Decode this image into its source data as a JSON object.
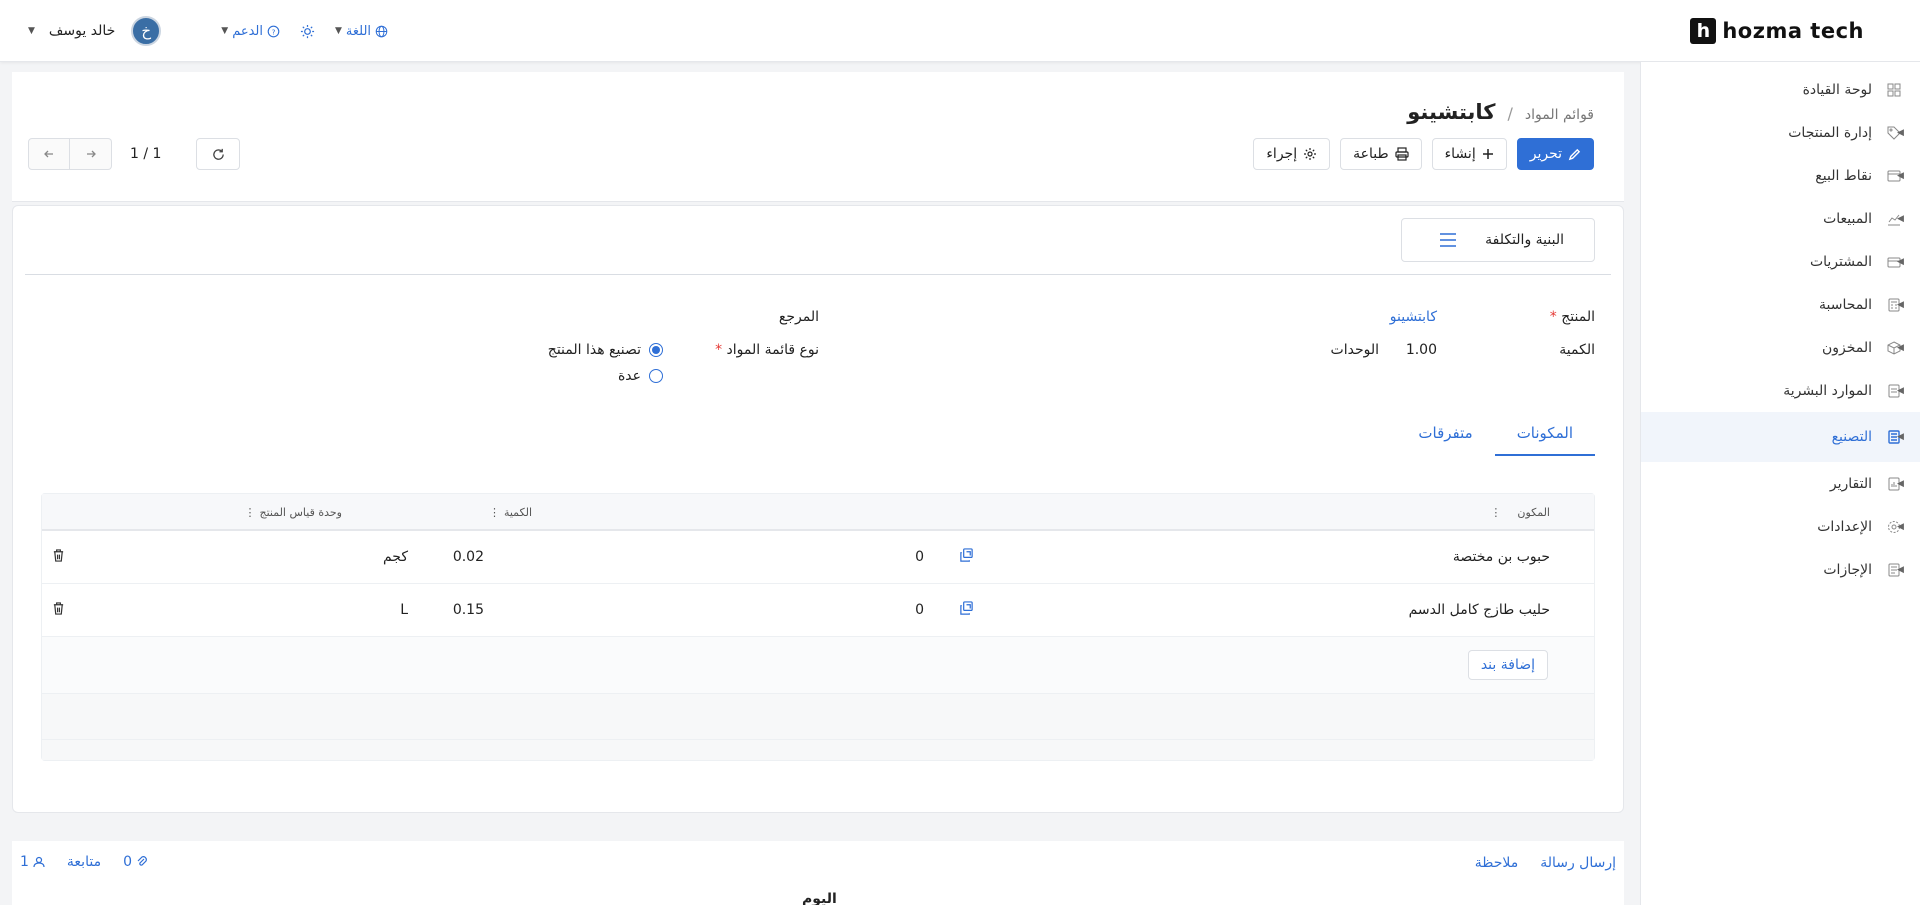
{
  "brand": {
    "logo_letter": "h",
    "name": "hozma tech"
  },
  "topbar": {
    "user_name": "خالد يوسف",
    "avatar_letter": "خ",
    "support_label": "الدعم",
    "language_label": "اللغة"
  },
  "sidebar": {
    "items": [
      {
        "label": "لوحة القيادة",
        "icon": "dashboard-icon"
      },
      {
        "label": "إدارة المنتجات",
        "icon": "tag-icon"
      },
      {
        "label": "نقاط البيع",
        "icon": "store-icon"
      },
      {
        "label": "المبيعات",
        "icon": "chart-icon"
      },
      {
        "label": "المشتريات",
        "icon": "cart-icon"
      },
      {
        "label": "المحاسبة",
        "icon": "calculator-icon"
      },
      {
        "label": "المخزون",
        "icon": "box-icon"
      },
      {
        "label": "الموارد البشرية",
        "icon": "people-icon"
      },
      {
        "label": "التصنيع",
        "icon": "factory-icon",
        "active": true
      },
      {
        "label": "التقارير",
        "icon": "report-icon"
      },
      {
        "label": "الإعدادات",
        "icon": "gear-icon"
      },
      {
        "label": "الإجازات",
        "icon": "calendar-icon"
      }
    ]
  },
  "header": {
    "breadcrumb_parent": "قوائم المواد",
    "breadcrumb_sep": "/",
    "title": "كابتشينو",
    "edit_label": "تحرير",
    "create_label": "إنشاء",
    "print_label": "طباعة",
    "action_label": "إجراء",
    "pager": "1 / 1"
  },
  "form": {
    "section_tab": "البنية والتكلفة",
    "product_label": "المنتج",
    "product_value": "كابتشينو",
    "qty_label": "الكمية",
    "qty_value": "1.00",
    "qty_unit": "الوحدات",
    "reference_label": "المرجع",
    "bom_type_label": "نوع قائمة المواد",
    "bom_type_options": [
      {
        "label": "تصنيع هذا المنتج",
        "selected": true
      },
      {
        "label": "عدة",
        "selected": false
      }
    ]
  },
  "tabs": [
    {
      "label": "المكونات",
      "active": true
    },
    {
      "label": "متفرقات",
      "active": false
    }
  ],
  "table": {
    "headers": {
      "component": "المكون",
      "quantity": "الكمية",
      "uom": "وحدة قياس المنتج"
    },
    "rows": [
      {
        "component": "حبوب بن مختصة",
        "mid": "0",
        "quantity": "0.02",
        "uom": "كجم"
      },
      {
        "component": "حليب طازج كامل الدسم",
        "mid": "0",
        "quantity": "0.15",
        "uom": "L"
      }
    ],
    "add_label": "إضافة بند"
  },
  "chatter": {
    "send_message": "إرسال رسالة",
    "note": "ملاحظة",
    "follow": "متابعة",
    "attachments": "0",
    "followers": "1",
    "today": "اليوم"
  }
}
